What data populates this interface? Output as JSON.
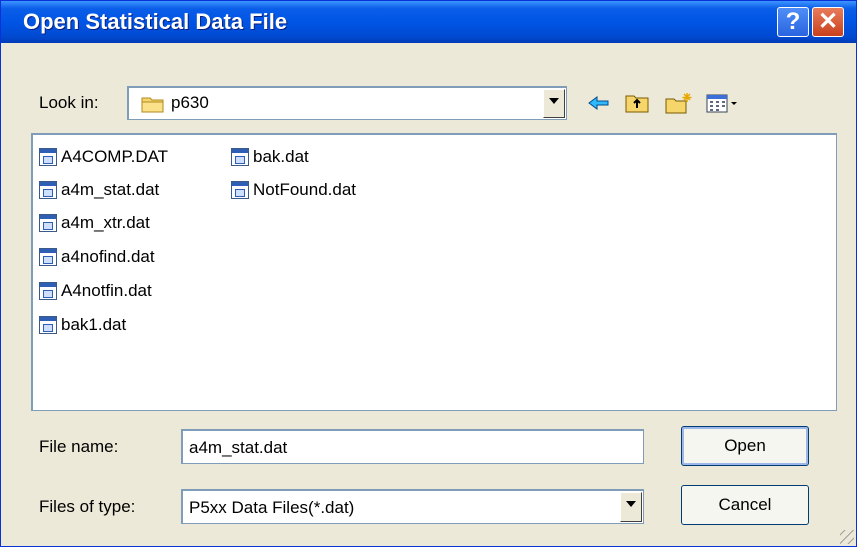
{
  "window": {
    "title": "Open Statistical Data File",
    "help_glyph": "?",
    "close_glyph": "✕"
  },
  "lookin": {
    "label": "Look in:",
    "value": "p630"
  },
  "toolbar": {
    "icons": [
      "back-arrow-icon",
      "up-folder-icon",
      "new-folder-icon",
      "view-menu-icon"
    ]
  },
  "files": [
    {
      "name": "A4COMP.DAT"
    },
    {
      "name": "a4m_stat.dat"
    },
    {
      "name": "a4m_xtr.dat"
    },
    {
      "name": "a4nofind.dat"
    },
    {
      "name": "A4notfin.dat"
    },
    {
      "name": "bak1.dat"
    },
    {
      "name": "bak.dat"
    },
    {
      "name": "NotFound.dat"
    }
  ],
  "filename": {
    "label": "File name:",
    "value": "a4m_stat.dat"
  },
  "filetype": {
    "label": "Files of type:",
    "value": "P5xx Data Files(*.dat)"
  },
  "buttons": {
    "open": "Open",
    "cancel": "Cancel"
  },
  "colors": {
    "titlebar": "#0055e5",
    "face": "#ece9d8",
    "border": "#7f9db9"
  }
}
